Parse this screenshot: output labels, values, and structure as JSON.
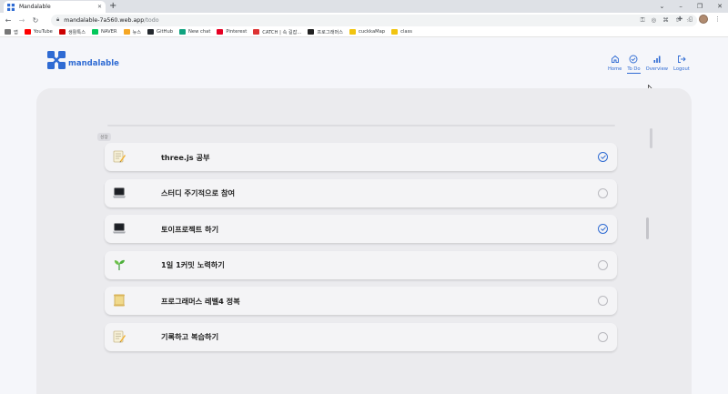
{
  "browser": {
    "tab_title": "Mandalable",
    "new_tab": "+",
    "url_host": "mandalable-7a560.web.app",
    "url_path": "/todo",
    "bookmarks": [
      "앱",
      "YouTube",
      "생활톡스",
      "NAVER",
      "뉴스",
      "GitHub",
      "New chat",
      "Pinterest",
      "CATCH | 속 길잡...",
      "프로그래머스",
      "cuckkaMap",
      "class"
    ]
  },
  "app": {
    "logo_text": "mandalable",
    "nav": [
      {
        "label": "Home",
        "icon": "home-icon"
      },
      {
        "label": "To Do",
        "icon": "check-circle-icon",
        "active": true
      },
      {
        "label": "Overview",
        "icon": "bar-chart-icon"
      },
      {
        "label": "Logout",
        "icon": "logout-icon"
      }
    ],
    "section_tag": "성장",
    "todos": [
      {
        "text": "three.js 공부",
        "done": true,
        "icon": "memo-icon"
      },
      {
        "text": "스터디 주기적으로 참여",
        "done": false,
        "icon": "laptop-icon"
      },
      {
        "text": "토이프로젝트 하기",
        "done": true,
        "icon": "laptop-icon"
      },
      {
        "text": "1일 1커밋 노력하기",
        "done": false,
        "icon": "seedling-icon"
      },
      {
        "text": "프로그래머스 레벨4 정복",
        "done": false,
        "icon": "scroll-icon"
      },
      {
        "text": "기록하고 복습하기",
        "done": false,
        "icon": "memo-icon"
      }
    ]
  },
  "colors": {
    "accent": "#2f6bd3",
    "panel": "#ebebee",
    "card": "#f4f4f6"
  }
}
